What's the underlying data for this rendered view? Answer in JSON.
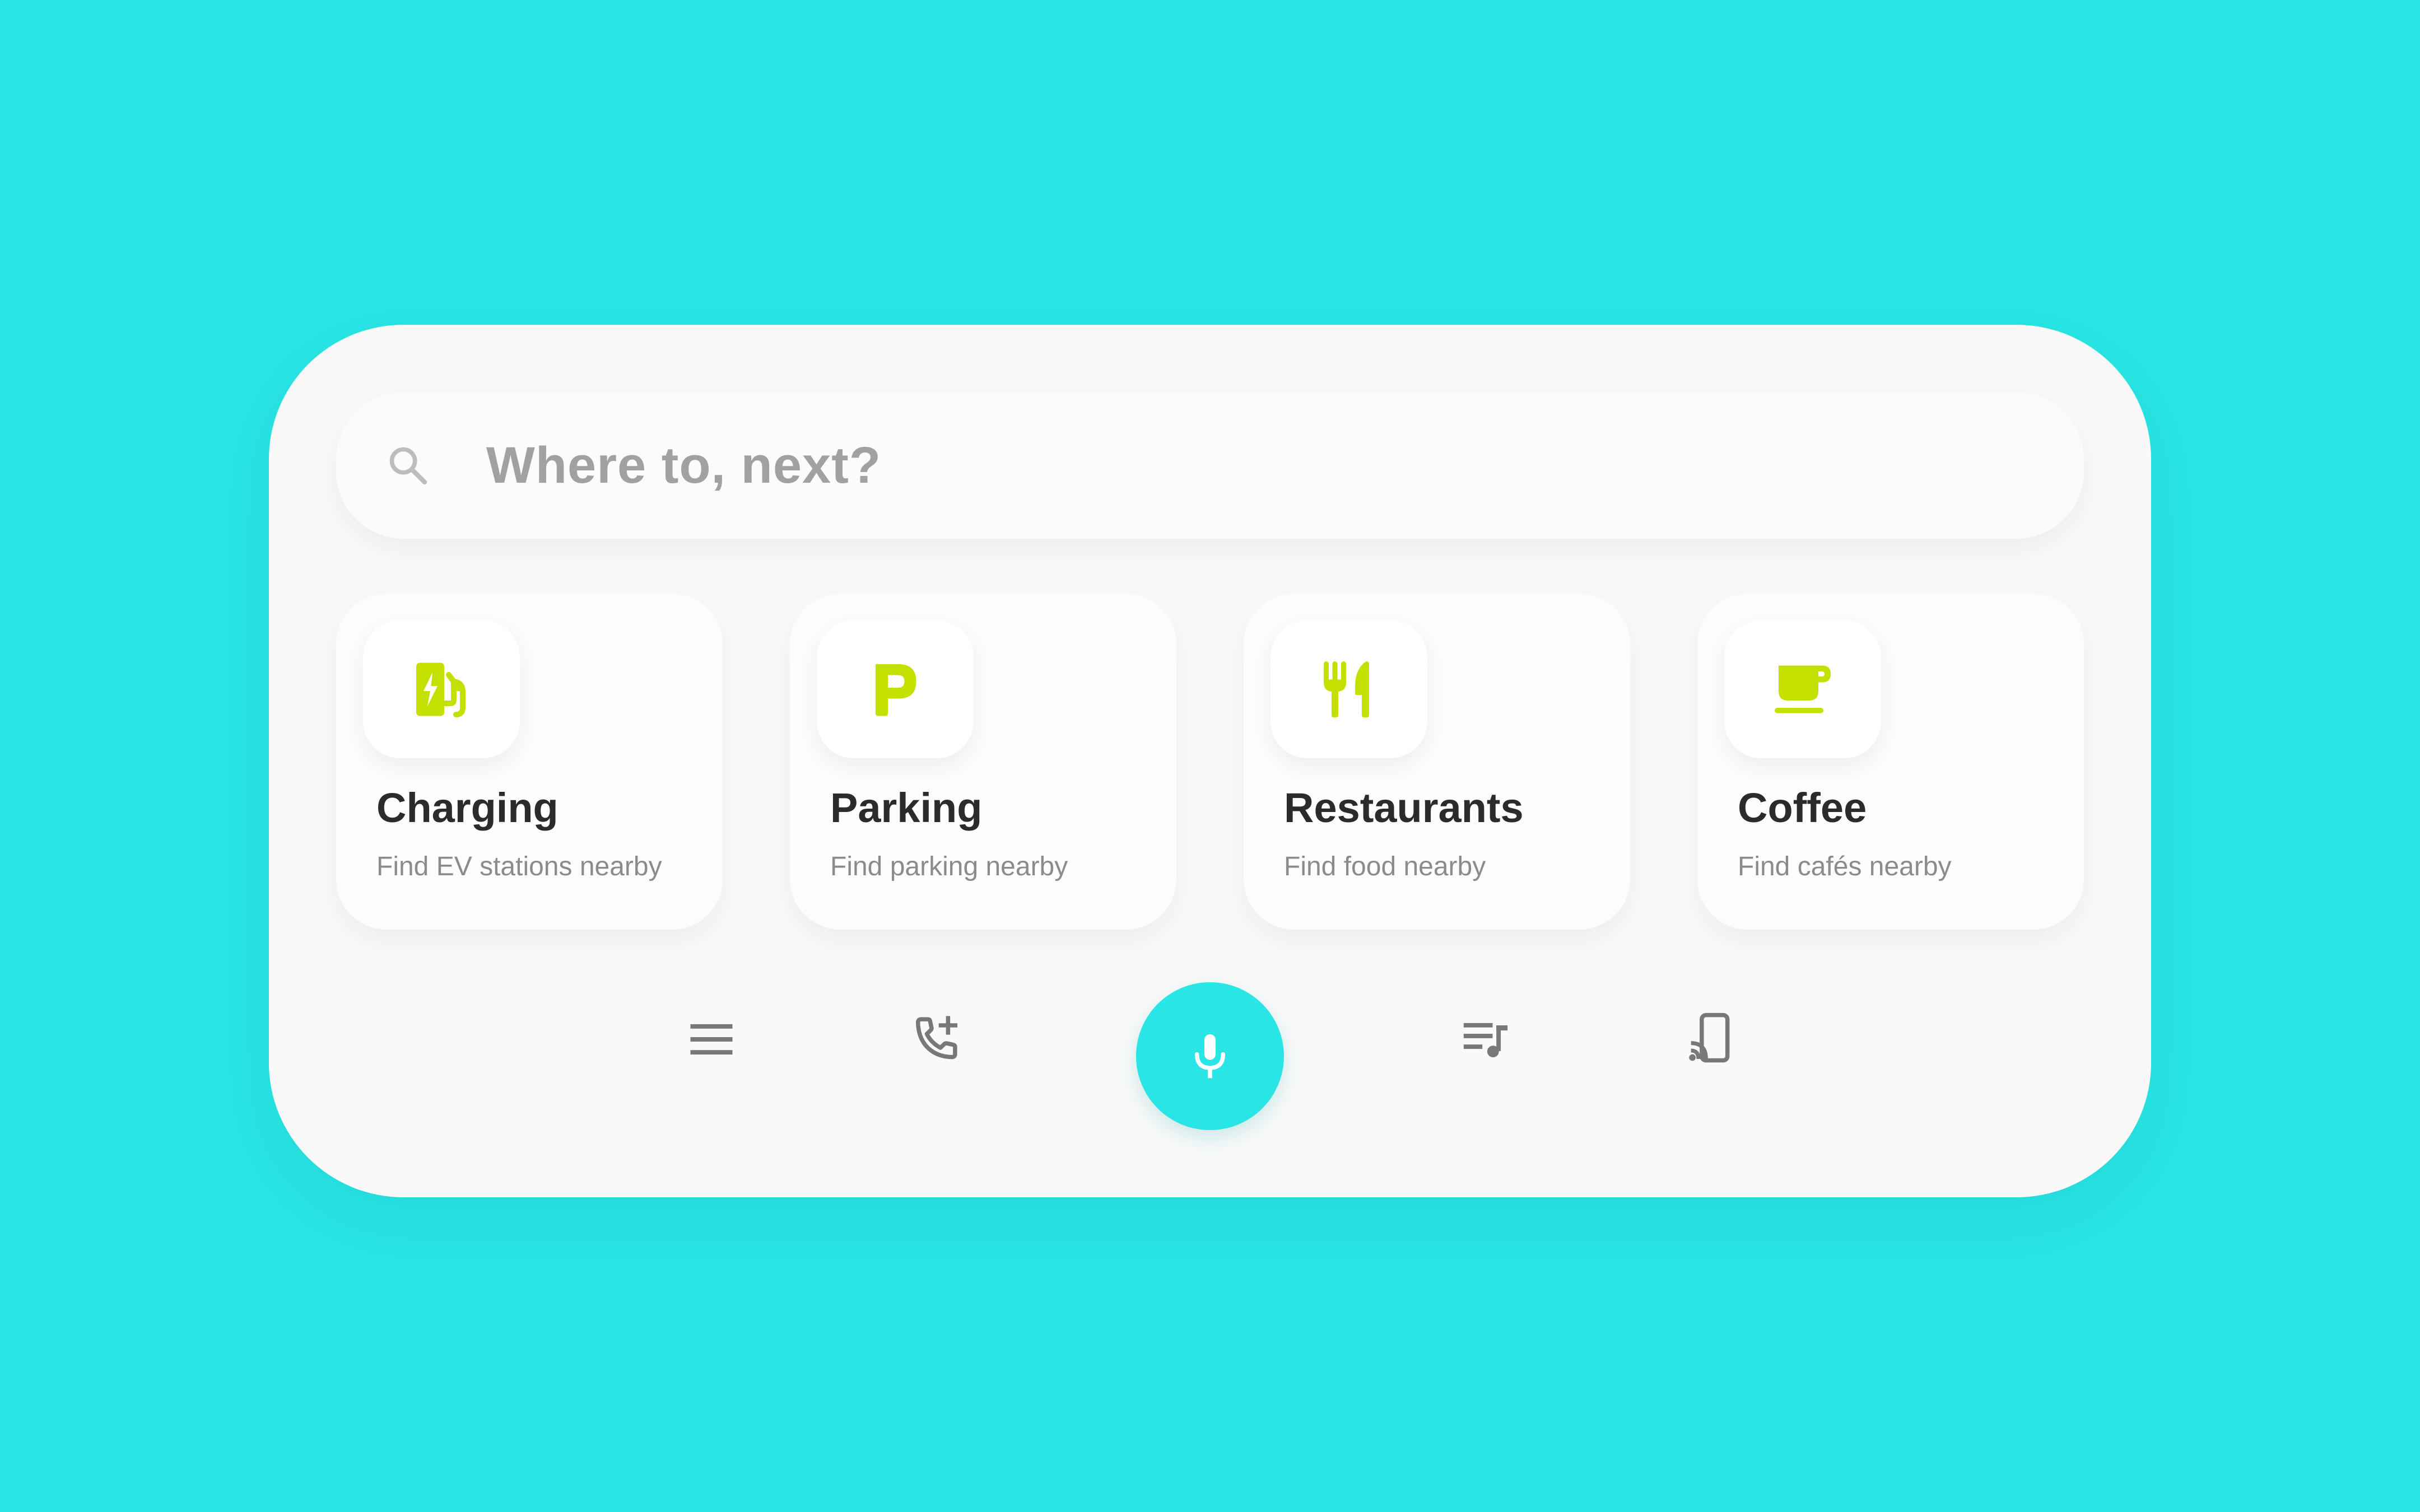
{
  "colors": {
    "background": "#29e5e5",
    "panel": "#f9f9f9",
    "accent_icon": "#c3e000",
    "mic": "#29e5e5",
    "title_text": "#2b2b2b",
    "sub_text": "#8b8b8b",
    "placeholder_text": "#a1a1a1",
    "nav_icon": "#787878"
  },
  "search": {
    "icon": "search-icon",
    "placeholder": "Where to, next?"
  },
  "cards": [
    {
      "icon": "ev-charging-icon",
      "title": "Charging",
      "subtitle": "Find EV stations nearby"
    },
    {
      "icon": "parking-icon",
      "title": "Parking",
      "subtitle": "Find parking nearby"
    },
    {
      "icon": "restaurant-icon",
      "title": "Restaurants",
      "subtitle": "Find food nearby"
    },
    {
      "icon": "coffee-icon",
      "title": "Coffee",
      "subtitle": "Find cafés nearby"
    }
  ],
  "bottom_bar": {
    "items": [
      "menu-icon",
      "add-call-icon",
      "microphone-icon",
      "music-queue-icon",
      "cast-device-icon"
    ]
  }
}
